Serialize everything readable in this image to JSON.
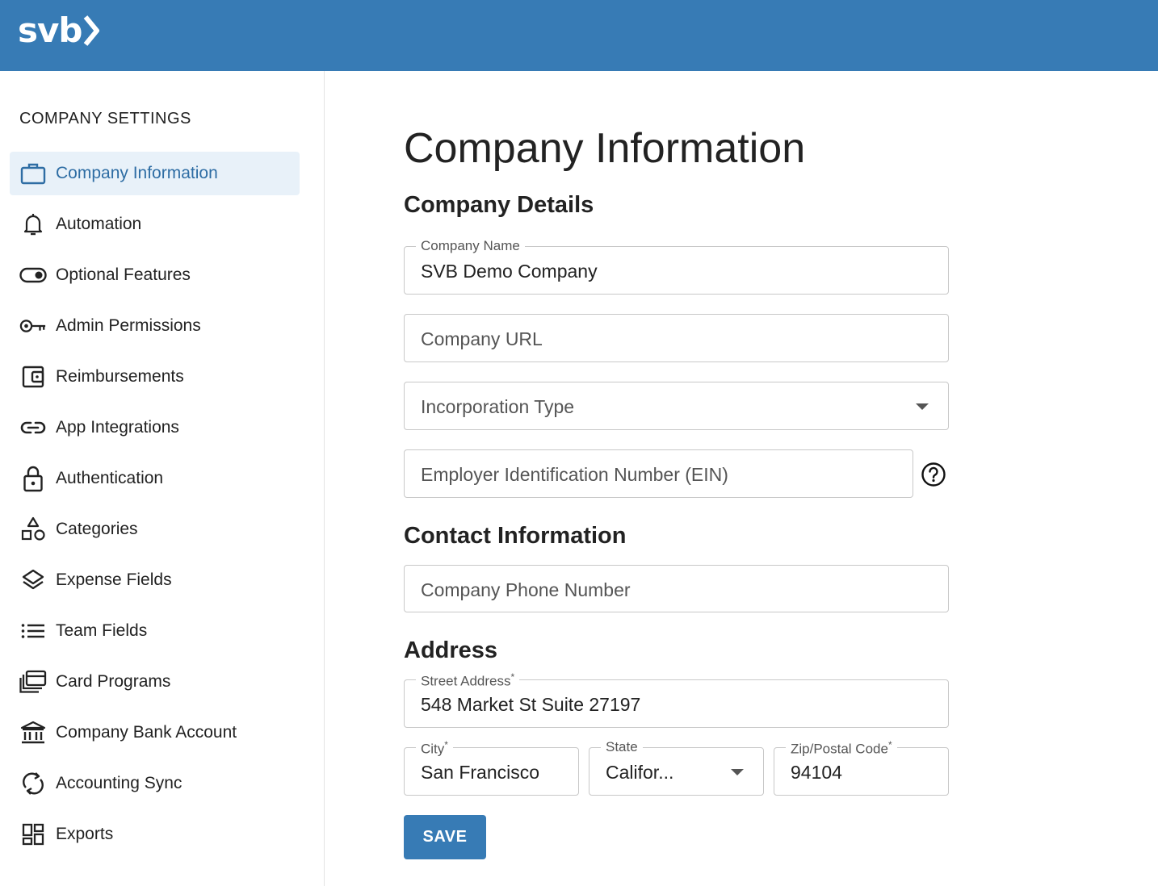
{
  "header": {
    "logo_text": "svb",
    "bar_color": "#377bb5"
  },
  "sidebar": {
    "heading": "COMPANY SETTINGS",
    "items": [
      {
        "label": "Company Information",
        "icon": "briefcase-icon",
        "active": true
      },
      {
        "label": "Automation",
        "icon": "bell-icon"
      },
      {
        "label": "Optional Features",
        "icon": "toggle-icon"
      },
      {
        "label": "Admin Permissions",
        "icon": "key-icon"
      },
      {
        "label": "Reimbursements",
        "icon": "wallet-icon"
      },
      {
        "label": "App Integrations",
        "icon": "link-icon"
      },
      {
        "label": "Authentication",
        "icon": "lock-icon"
      },
      {
        "label": "Categories",
        "icon": "shapes-icon"
      },
      {
        "label": "Expense Fields",
        "icon": "layers-icon"
      },
      {
        "label": "Team Fields",
        "icon": "list-icon"
      },
      {
        "label": "Card Programs",
        "icon": "cards-icon"
      },
      {
        "label": "Company Bank Account",
        "icon": "bank-icon"
      },
      {
        "label": "Accounting Sync",
        "icon": "sync-icon"
      },
      {
        "label": "Exports",
        "icon": "dashboard-icon"
      }
    ]
  },
  "main": {
    "title": "Company Information",
    "company_details": {
      "heading": "Company Details",
      "company_name_label": "Company Name",
      "company_name_value": "SVB Demo Company",
      "company_url_placeholder": "Company URL",
      "incorporation_type_placeholder": "Incorporation Type",
      "ein_placeholder": "Employer Identification Number (EIN)"
    },
    "contact": {
      "heading": "Contact Information",
      "phone_placeholder": "Company Phone Number"
    },
    "address": {
      "heading": "Address",
      "street_label": "Street Address",
      "street_value": "548 Market St Suite 27197",
      "city_label": "City",
      "city_value": "San Francisco",
      "state_label": "State",
      "state_value": "Califor...",
      "zip_label": "Zip/Postal Code",
      "zip_value": "94104",
      "required_mark": "*"
    },
    "save_label": "SAVE"
  }
}
